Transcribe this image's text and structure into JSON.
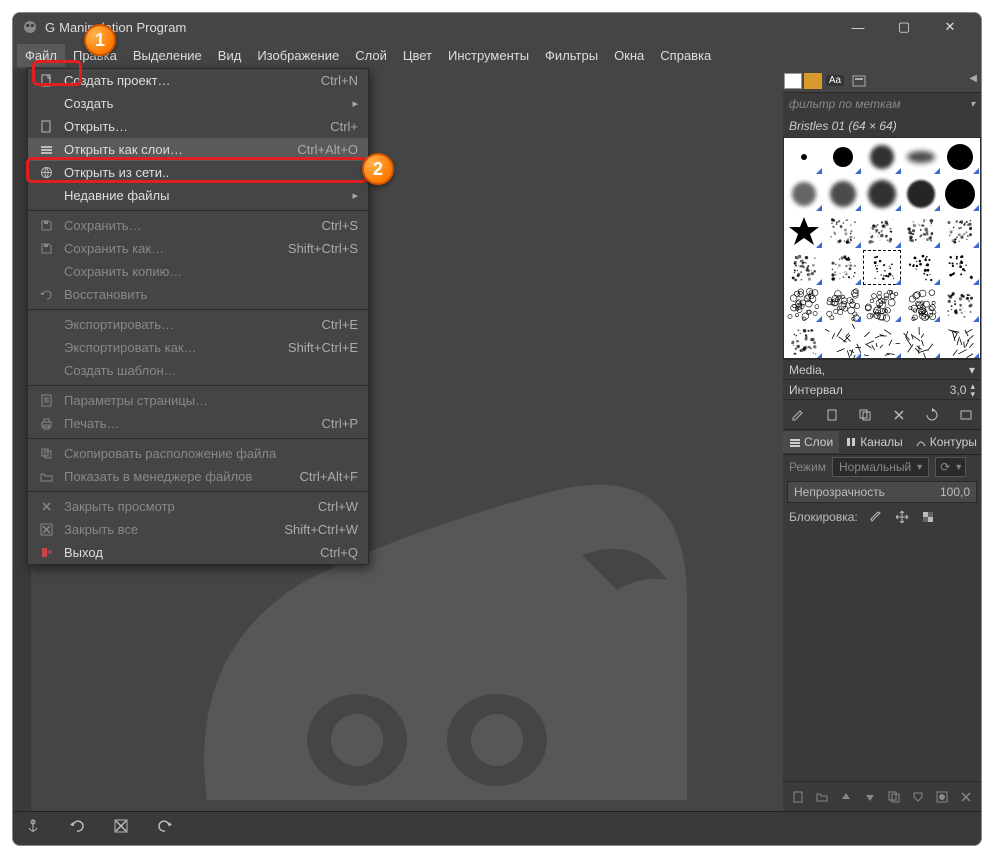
{
  "titlebar": {
    "title": "Manipulation Program"
  },
  "win_controls": {
    "min": "—",
    "max": "▢",
    "close": "✕"
  },
  "menubar": [
    "Файл",
    "Правка",
    "Выделение",
    "Вид",
    "Изображение",
    "Слой",
    "Цвет",
    "Инструменты",
    "Фильтры",
    "Окна",
    "Справка"
  ],
  "file_menu": {
    "groups": [
      [
        {
          "icon": "new-doc",
          "label": "Создать проект…",
          "accel": "Ctrl+N"
        },
        {
          "icon": "blank",
          "label": "Создать",
          "sub": true
        },
        {
          "icon": "open",
          "label": "Открыть…",
          "accel": "Ctrl+"
        },
        {
          "icon": "layers",
          "label": "Открыть как слои…",
          "accel": "Ctrl+Alt+O",
          "highlight": true
        },
        {
          "icon": "globe",
          "label": "Открыть из сети..",
          "accel": ""
        },
        {
          "icon": "blank",
          "label": "Недавние файлы",
          "sub": true
        }
      ],
      [
        {
          "icon": "save",
          "label": "Сохранить…",
          "accel": "Ctrl+S",
          "disabled": true
        },
        {
          "icon": "saveas",
          "label": "Сохранить как…",
          "accel": "Shift+Ctrl+S",
          "disabled": true
        },
        {
          "icon": "blank",
          "label": "Сохранить копию…",
          "accel": "",
          "disabled": true
        },
        {
          "icon": "revert",
          "label": "Восстановить",
          "accel": "",
          "disabled": true
        }
      ],
      [
        {
          "icon": "blank",
          "label": "Экспортировать…",
          "accel": "Ctrl+E",
          "disabled": true
        },
        {
          "icon": "blank",
          "label": "Экспортировать как…",
          "accel": "Shift+Ctrl+E",
          "disabled": true
        },
        {
          "icon": "blank",
          "label": "Создать шаблон…",
          "accel": "",
          "disabled": true
        }
      ],
      [
        {
          "icon": "page",
          "label": "Параметры страницы…",
          "accel": "",
          "disabled": true
        },
        {
          "icon": "print",
          "label": "Печать…",
          "accel": "Ctrl+P",
          "disabled": true
        }
      ],
      [
        {
          "icon": "copy",
          "label": "Скопировать расположение файла",
          "accel": "",
          "disabled": true
        },
        {
          "icon": "folder",
          "label": "Показать в менеджере файлов",
          "accel": "Ctrl+Alt+F",
          "disabled": true
        }
      ],
      [
        {
          "icon": "close",
          "label": "Закрыть просмотр",
          "accel": "Ctrl+W",
          "disabled": true
        },
        {
          "icon": "closeall",
          "label": "Закрыть все",
          "accel": "Shift+Ctrl+W",
          "disabled": true
        },
        {
          "icon": "exit",
          "label": "Выход",
          "accel": "Ctrl+Q"
        }
      ]
    ]
  },
  "brushes": {
    "filter_placeholder": "фильтр по меткам",
    "name": "Bristles 01 (64 × 64)",
    "media_label": "Media,",
    "interval_label": "Интервал",
    "interval_value": "3,0"
  },
  "layers": {
    "tabs": [
      "Слои",
      "Каналы",
      "Контуры"
    ],
    "mode_label": "Режим",
    "mode_value": "Нормальный",
    "opacity_label": "Непрозрачность",
    "opacity_value": "100,0",
    "lock_label": "Блокировка:"
  },
  "annotations": {
    "b1": "1",
    "b2": "2"
  }
}
